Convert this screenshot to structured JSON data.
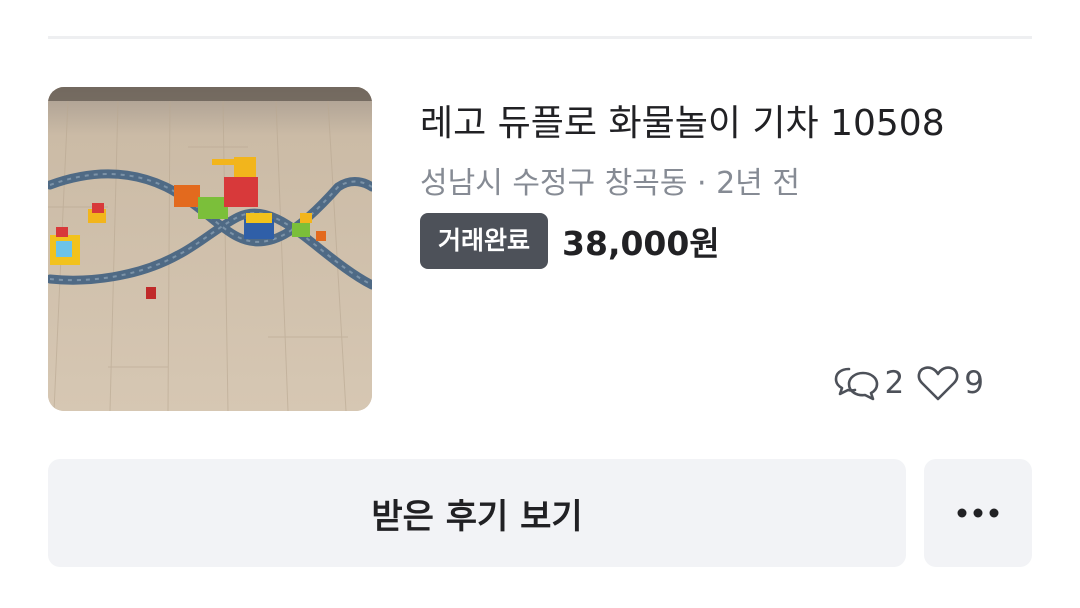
{
  "item": {
    "title": "레고 듀플로 화물놀이 기차 10508",
    "location": "성남시 수정구 창곡동",
    "separator": " · ",
    "time_ago": "2년 전",
    "status_badge": "거래완료",
    "price": "38,000원",
    "thumbnail": "lego-duplo-train-photo",
    "chat_count": "2",
    "like_count": "9"
  },
  "actions": {
    "review_button_label": "받은 후기 보기",
    "more_icon": "more-horizontal-icon"
  },
  "icons": {
    "chat": "chat-bubbles-icon",
    "like": "heart-icon"
  },
  "colors": {
    "badge_bg": "#4d5159",
    "muted_text": "#868b94",
    "button_bg": "#f2f3f6",
    "divider": "#eeeff1"
  }
}
